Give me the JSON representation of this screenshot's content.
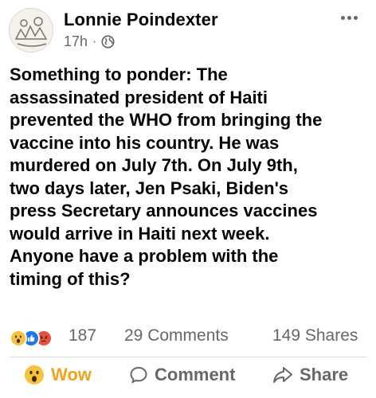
{
  "post": {
    "author": "Lonnie Poindexter",
    "time": "17h",
    "separator": "·",
    "privacy_icon": "globe-icon",
    "text": "Something to ponder: The\nassassinated president of Haiti\nprevented the WHO from bringing the\nvaccine into his country. He was\nmurdered on July 7th. On July 9th,\ntwo days later, Jen Psaki, Biden's\npress Secretary announces vaccines\nwould arrive in Haiti next week.\nAnyone have a problem with the\ntiming of this?"
  },
  "stats": {
    "reactions": [
      "wow",
      "like",
      "angry"
    ],
    "reaction_count": "187",
    "comments": "29 Comments",
    "shares": "149 Shares"
  },
  "actions": {
    "reaction_label": "Wow",
    "comment_label": "Comment",
    "share_label": "Share"
  },
  "colors": {
    "wow": "#f2a21b",
    "like": "#1877f2",
    "angry": "#e4533a",
    "secondary_text": "#65676b"
  }
}
